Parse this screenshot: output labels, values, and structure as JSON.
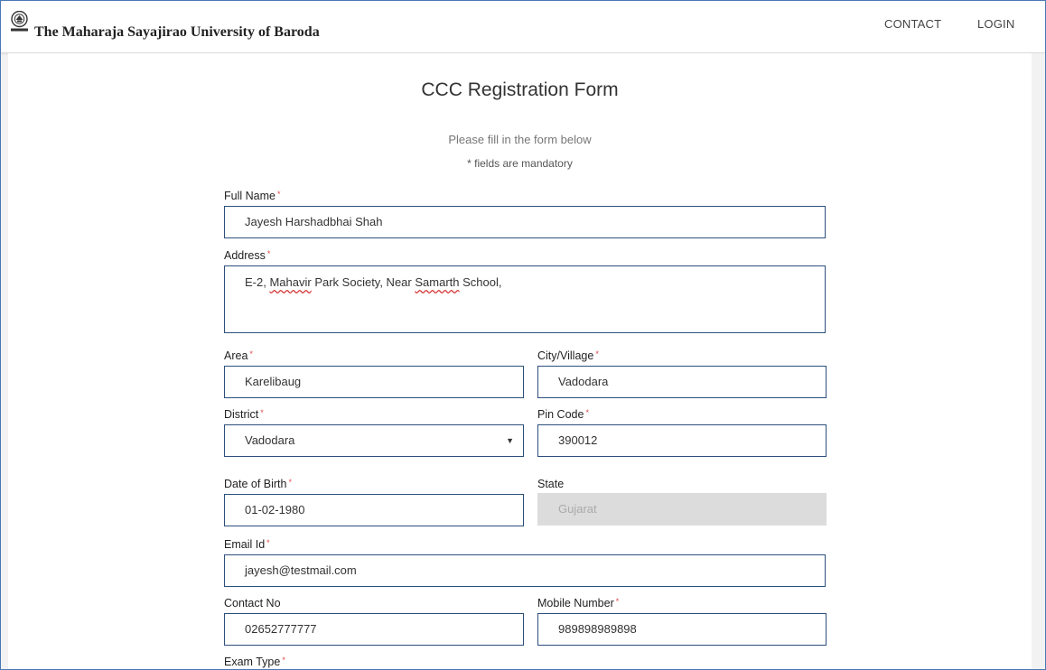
{
  "header": {
    "brand": "The Maharaja Sayajirao University of Baroda",
    "nav": {
      "contact": "CONTACT",
      "login": "LOGIN"
    }
  },
  "form": {
    "title": "CCC Registration Form",
    "subtitle": "Please fill in the form below",
    "mandatory_note": "* fields are mandatory",
    "required_mark": "*",
    "full_name": {
      "label": "Full Name",
      "value": "Jayesh Harshadbhai Shah"
    },
    "address": {
      "label": "Address",
      "value_part1": "E-2, ",
      "value_part2": "Mahavir",
      "value_part3": " Park Society, Near ",
      "value_part4": "Samarth",
      "value_part5": " School,"
    },
    "area": {
      "label": "Area",
      "value": "Karelibaug"
    },
    "city": {
      "label": "City/Village",
      "value": "Vadodara"
    },
    "district": {
      "label": "District",
      "value": "Vadodara"
    },
    "pin_code": {
      "label": "Pin Code",
      "value": "390012"
    },
    "dob": {
      "label": "Date of Birth",
      "value": "01-02-1980"
    },
    "state": {
      "label": "State",
      "value": "Gujarat"
    },
    "email": {
      "label": "Email Id",
      "value": "jayesh@testmail.com"
    },
    "contact_no": {
      "label": "Contact No",
      "value": "02652777777"
    },
    "mobile": {
      "label": "Mobile Number",
      "value": "989898989898"
    },
    "exam_type": {
      "label": "Exam Type"
    }
  },
  "icons": {
    "logo": "university-seal-icon",
    "dropdown": "dropdown-arrow-icon"
  },
  "colors": {
    "input_border": "#2d4f7c",
    "required": "#e0484a",
    "disabled_bg": "#dcdcdc"
  }
}
